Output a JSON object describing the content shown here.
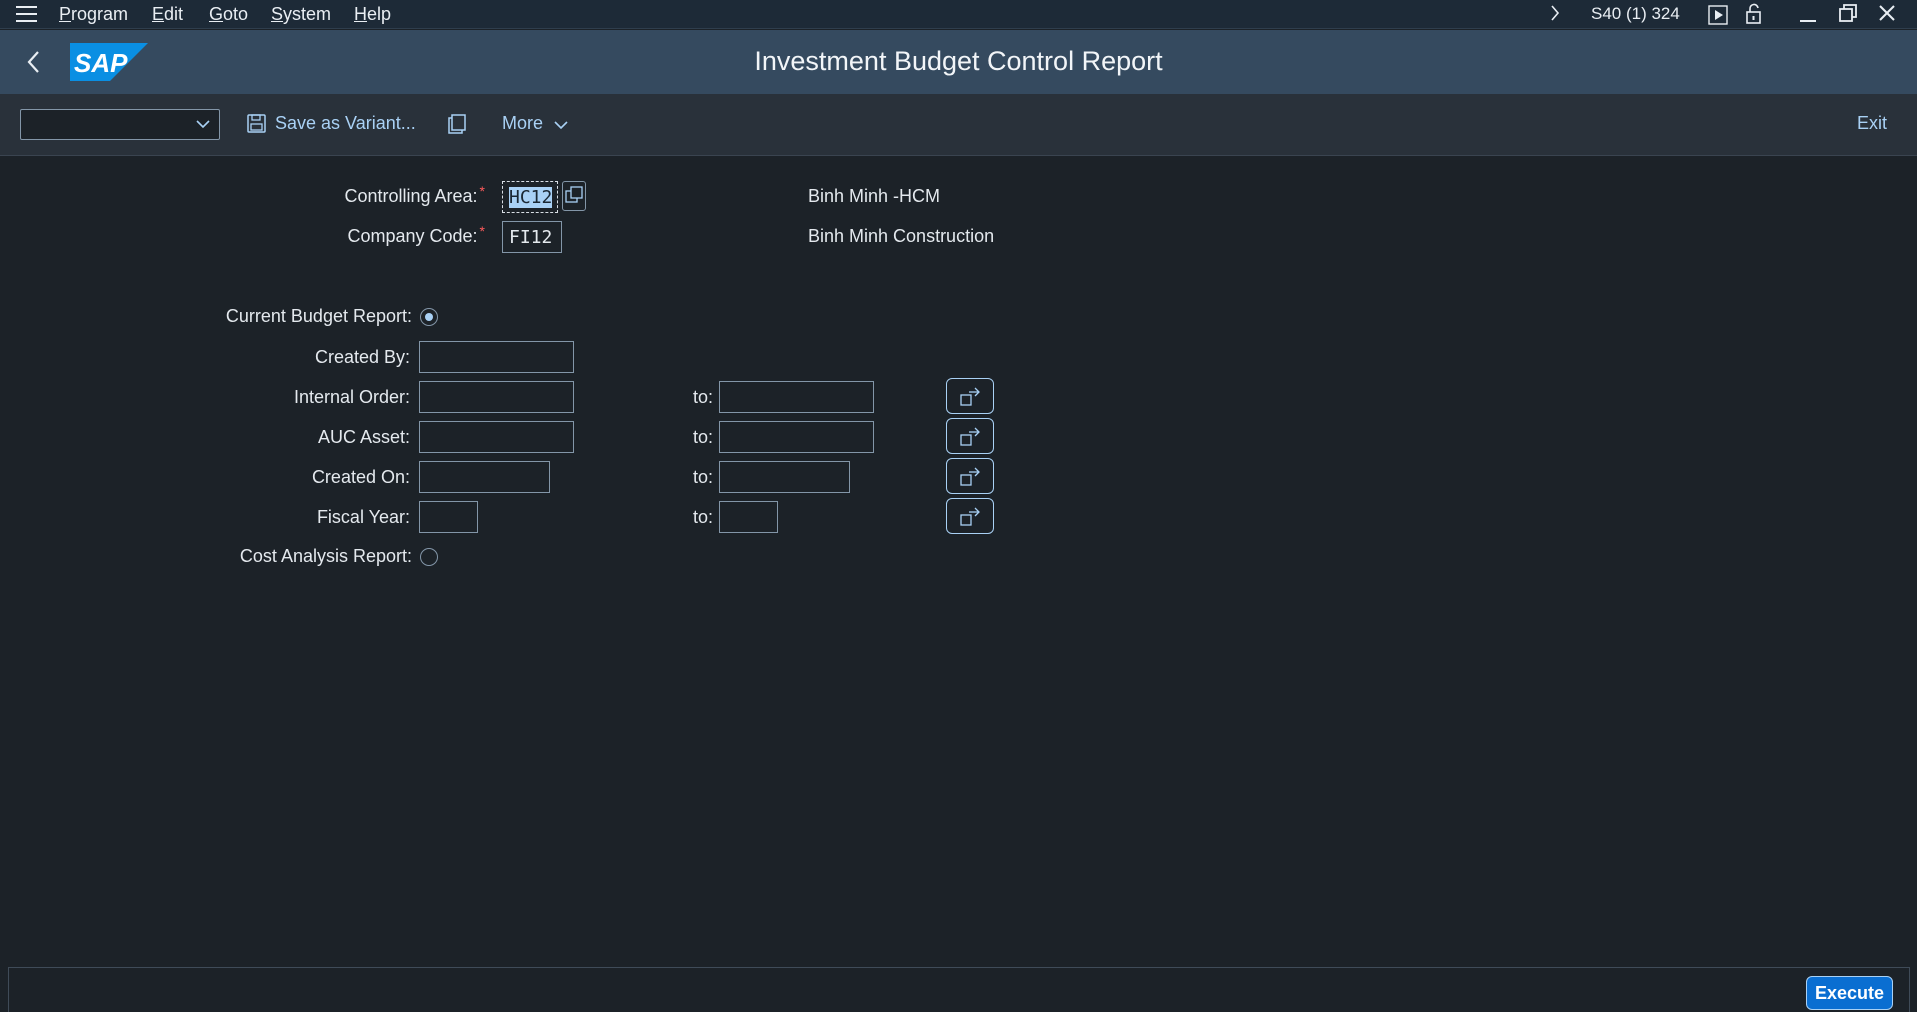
{
  "menu": {
    "items": [
      "Program",
      "Edit",
      "Goto",
      "System",
      "Help"
    ],
    "system_info": "S40 (1) 324"
  },
  "header": {
    "title": "Investment Budget Control Report",
    "logo_text": "SAP"
  },
  "toolbar": {
    "variant_value": "",
    "save_variant_label": "Save as Variant...",
    "more_label": "More",
    "exit_label": "Exit"
  },
  "form": {
    "controlling_area": {
      "label": "Controlling Area:",
      "value": "HC12",
      "description": "Binh Minh -HCM"
    },
    "company_code": {
      "label": "Company Code:",
      "value": "FI12",
      "description": "Binh Minh Construction"
    },
    "current_budget_report": {
      "label": "Current Budget Report:",
      "selected": true
    },
    "created_by": {
      "label": "Created By:",
      "value": ""
    },
    "internal_order": {
      "label": "Internal Order:",
      "from": "",
      "to": ""
    },
    "auc_asset": {
      "label": "AUC Asset:",
      "from": "",
      "to": ""
    },
    "created_on": {
      "label": "Created On:",
      "from": "",
      "to": ""
    },
    "fiscal_year": {
      "label": "Fiscal Year:",
      "from": "",
      "to": ""
    },
    "to_label": "to:",
    "cost_analysis_report": {
      "label": "Cost Analysis Report:",
      "selected": false
    }
  },
  "footer": {
    "execute_label": "Execute"
  },
  "colors": {
    "accent": "#a9d1f5",
    "shell_header": "#354a5f",
    "background": "#1c2228",
    "required": "#ff5c5c",
    "execute": "#0a6ed1"
  }
}
